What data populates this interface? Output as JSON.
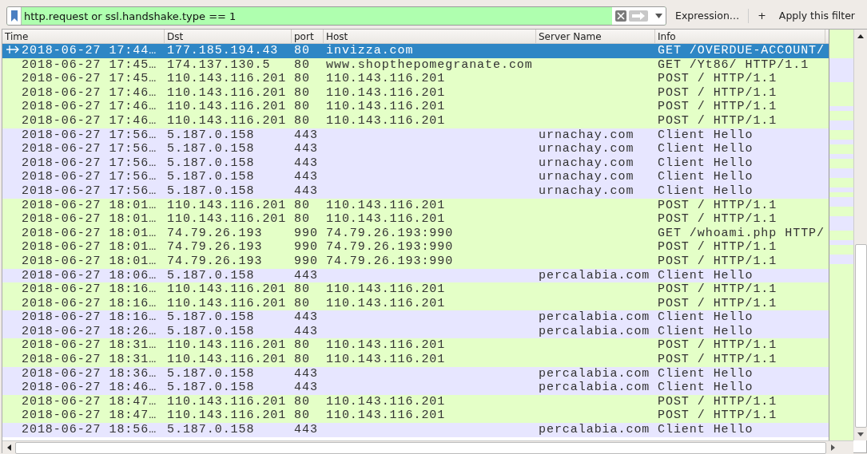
{
  "filter": {
    "value": "http.request or ssl.handshake.type == 1",
    "expression_button": "Expression…",
    "add_button": "+",
    "apply_button": "Apply this filter"
  },
  "columns": [
    "Time",
    "Dst",
    "port",
    "Host",
    "Server Name",
    "Info"
  ],
  "rows": [
    {
      "selected": true,
      "cells": [
        "2018-06-27 17:44…",
        "177.185.194.43",
        "80",
        "invizza.com",
        "",
        "GET /OVERDUE-ACCOUNT/"
      ]
    },
    {
      "kind": "http",
      "selected": false,
      "cells": [
        "2018-06-27 17:45…",
        "174.137.130.5",
        "80",
        "www.shopthepomegranate.com",
        "",
        "GET /Yt86/ HTTP/1.1"
      ]
    },
    {
      "kind": "http",
      "selected": false,
      "cells": [
        "2018-06-27 17:45…",
        "110.143.116.201",
        "80",
        "110.143.116.201",
        "",
        "POST / HTTP/1.1"
      ]
    },
    {
      "kind": "http",
      "selected": false,
      "cells": [
        "2018-06-27 17:46…",
        "110.143.116.201",
        "80",
        "110.143.116.201",
        "",
        "POST / HTTP/1.1"
      ]
    },
    {
      "kind": "http",
      "selected": false,
      "cells": [
        "2018-06-27 17:46…",
        "110.143.116.201",
        "80",
        "110.143.116.201",
        "",
        "POST / HTTP/1.1"
      ]
    },
    {
      "kind": "http",
      "selected": false,
      "cells": [
        "2018-06-27 17:46…",
        "110.143.116.201",
        "80",
        "110.143.116.201",
        "",
        "POST / HTTP/1.1"
      ]
    },
    {
      "kind": "tls",
      "selected": false,
      "cells": [
        "2018-06-27 17:56…",
        "5.187.0.158",
        "443",
        "",
        "urnachay.com",
        "Client Hello"
      ]
    },
    {
      "kind": "tls",
      "selected": false,
      "cells": [
        "2018-06-27 17:56…",
        "5.187.0.158",
        "443",
        "",
        "urnachay.com",
        "Client Hello"
      ]
    },
    {
      "kind": "tls",
      "selected": false,
      "cells": [
        "2018-06-27 17:56…",
        "5.187.0.158",
        "443",
        "",
        "urnachay.com",
        "Client Hello"
      ]
    },
    {
      "kind": "tls",
      "selected": false,
      "cells": [
        "2018-06-27 17:56…",
        "5.187.0.158",
        "443",
        "",
        "urnachay.com",
        "Client Hello"
      ]
    },
    {
      "kind": "tls",
      "selected": false,
      "cells": [
        "2018-06-27 17:56…",
        "5.187.0.158",
        "443",
        "",
        "urnachay.com",
        "Client Hello"
      ]
    },
    {
      "kind": "http",
      "selected": false,
      "cells": [
        "2018-06-27 18:01…",
        "110.143.116.201",
        "80",
        "110.143.116.201",
        "",
        "POST / HTTP/1.1"
      ]
    },
    {
      "kind": "http",
      "selected": false,
      "cells": [
        "2018-06-27 18:01…",
        "110.143.116.201",
        "80",
        "110.143.116.201",
        "",
        "POST / HTTP/1.1"
      ]
    },
    {
      "kind": "http",
      "selected": false,
      "cells": [
        "2018-06-27 18:01…",
        "74.79.26.193",
        "990",
        "74.79.26.193:990",
        "",
        "GET /whoami.php HTTP/"
      ]
    },
    {
      "kind": "http",
      "selected": false,
      "cells": [
        "2018-06-27 18:01…",
        "74.79.26.193",
        "990",
        "74.79.26.193:990",
        "",
        "POST / HTTP/1.1"
      ]
    },
    {
      "kind": "http",
      "selected": false,
      "cells": [
        "2018-06-27 18:01…",
        "74.79.26.193",
        "990",
        "74.79.26.193:990",
        "",
        "POST / HTTP/1.1"
      ]
    },
    {
      "kind": "tls",
      "selected": false,
      "cells": [
        "2018-06-27 18:06…",
        "5.187.0.158",
        "443",
        "",
        "percalabia.com",
        "Client Hello"
      ]
    },
    {
      "kind": "http",
      "selected": false,
      "cells": [
        "2018-06-27 18:16…",
        "110.143.116.201",
        "80",
        "110.143.116.201",
        "",
        "POST / HTTP/1.1"
      ]
    },
    {
      "kind": "http",
      "selected": false,
      "cells": [
        "2018-06-27 18:16…",
        "110.143.116.201",
        "80",
        "110.143.116.201",
        "",
        "POST / HTTP/1.1"
      ]
    },
    {
      "kind": "tls",
      "selected": false,
      "cells": [
        "2018-06-27 18:16…",
        "5.187.0.158",
        "443",
        "",
        "percalabia.com",
        "Client Hello"
      ]
    },
    {
      "kind": "tls",
      "selected": false,
      "cells": [
        "2018-06-27 18:26…",
        "5.187.0.158",
        "443",
        "",
        "percalabia.com",
        "Client Hello"
      ]
    },
    {
      "kind": "http",
      "selected": false,
      "cells": [
        "2018-06-27 18:31…",
        "110.143.116.201",
        "80",
        "110.143.116.201",
        "",
        "POST / HTTP/1.1"
      ]
    },
    {
      "kind": "http",
      "selected": false,
      "cells": [
        "2018-06-27 18:31…",
        "110.143.116.201",
        "80",
        "110.143.116.201",
        "",
        "POST / HTTP/1.1"
      ]
    },
    {
      "kind": "tls",
      "selected": false,
      "cells": [
        "2018-06-27 18:36…",
        "5.187.0.158",
        "443",
        "",
        "percalabia.com",
        "Client Hello"
      ]
    },
    {
      "kind": "tls",
      "selected": false,
      "cells": [
        "2018-06-27 18:46…",
        "5.187.0.158",
        "443",
        "",
        "percalabia.com",
        "Client Hello"
      ]
    },
    {
      "kind": "http",
      "selected": false,
      "cells": [
        "2018-06-27 18:47…",
        "110.143.116.201",
        "80",
        "110.143.116.201",
        "",
        "POST / HTTP/1.1"
      ]
    },
    {
      "kind": "http",
      "selected": false,
      "cells": [
        "2018-06-27 18:47…",
        "110.143.116.201",
        "80",
        "110.143.116.201",
        "",
        "POST / HTTP/1.1"
      ]
    },
    {
      "kind": "tls",
      "selected": false,
      "cells": [
        "2018-06-27 18:56…",
        "5.187.0.158",
        "443",
        "",
        "percalabia.com",
        "Client Hello"
      ]
    }
  ]
}
